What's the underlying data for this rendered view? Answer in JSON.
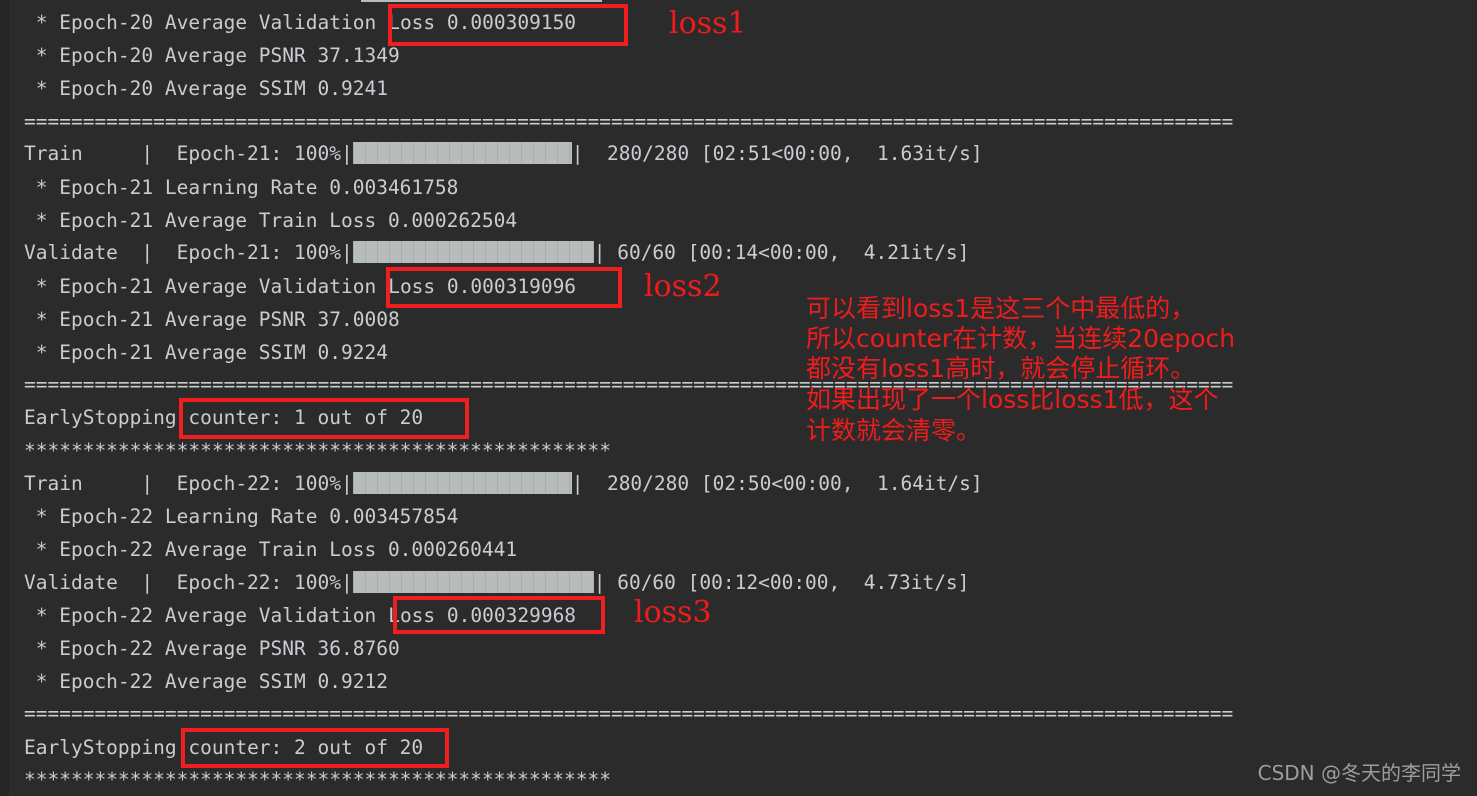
{
  "terminal": {
    "background_color": "#2b2b2b",
    "text_color": "#c9ccd1",
    "accent_color": "#ef1c1c",
    "bar_color": "#b9bcbd",
    "separator_equals": "=======================================================================================================",
    "separator_stars": "**************************************************"
  },
  "log_lines": [
    {
      "id": "e20_val_loss_prefix",
      "text": " * Epoch-20 Average Validation"
    },
    {
      "id": "e20_val_loss_value",
      "text": "Loss 0.000309150"
    },
    {
      "id": "e20_psnr",
      "text": " * Epoch-20 Average PSNR 37.1349"
    },
    {
      "id": "e20_ssim",
      "text": " * Epoch-20 Average SSIM 0.9241"
    },
    {
      "id": "e21_train_prefix",
      "text": "Train     |  Epoch-21: 100%|"
    },
    {
      "id": "e21_train_suffix",
      "text": "|  280/280 [02:51<00:00,  1.63it/s]"
    },
    {
      "id": "e21_lr",
      "text": " * Epoch-21 Learning Rate 0.003461758"
    },
    {
      "id": "e21_train_loss",
      "text": " * Epoch-21 Average Train Loss 0.000262504"
    },
    {
      "id": "e21_val_prefix",
      "text": "Validate  |  Epoch-21: 100%|"
    },
    {
      "id": "e21_val_suffix",
      "text": "| 60/60 [00:14<00:00,  4.21it/s]"
    },
    {
      "id": "e21_val_loss_prefix",
      "text": " * Epoch-21 Average Validation"
    },
    {
      "id": "e21_val_loss_value",
      "text": "Loss 0.000319096"
    },
    {
      "id": "e21_psnr",
      "text": " * Epoch-21 Average PSNR 37.0008"
    },
    {
      "id": "e21_ssim",
      "text": " * Epoch-21 Average SSIM 0.9224"
    },
    {
      "id": "es1_prefix",
      "text": "EarlyStopping"
    },
    {
      "id": "es1_counter",
      "text": " counter: 1 out of 20"
    },
    {
      "id": "e22_train_prefix",
      "text": "Train     |  Epoch-22: 100%|"
    },
    {
      "id": "e22_train_suffix",
      "text": "|  280/280 [02:50<00:00,  1.64it/s]"
    },
    {
      "id": "e22_lr",
      "text": " * Epoch-22 Learning Rate 0.003457854"
    },
    {
      "id": "e22_train_loss",
      "text": " * Epoch-22 Average Train Loss 0.000260441"
    },
    {
      "id": "e22_val_prefix",
      "text": "Validate  |  Epoch-22: 100%|"
    },
    {
      "id": "e22_val_suffix",
      "text": "| 60/60 [00:12<00:00,  4.73it/s]"
    },
    {
      "id": "e22_val_loss_prefix",
      "text": " * Epoch-22 Average Validation"
    },
    {
      "id": "e22_val_loss_value",
      "text": "Loss 0.000329968"
    },
    {
      "id": "e22_psnr",
      "text": " * Epoch-22 Average PSNR 36.8760"
    },
    {
      "id": "e22_ssim",
      "text": " * Epoch-22 Average SSIM 0.9212"
    },
    {
      "id": "es2_prefix",
      "text": "EarlyStopping"
    },
    {
      "id": "es2_counter",
      "text": " counter: 2 out of 20"
    }
  ],
  "annotations": {
    "loss1_label": "loss1",
    "loss2_label": "loss2",
    "loss3_label": "loss3",
    "chinese_note_line1": "可以看到loss1是这三个中最低的，",
    "chinese_note_line2": "所以counter在计数，当连续20epoch",
    "chinese_note_line3": "都没有loss1高时，就会停止循环。",
    "chinese_note_line4": "如果出现了一个loss比loss1低，这个",
    "chinese_note_line5": "计数就会清零。"
  },
  "watermark": {
    "text": "CSDN @冬天的李同学"
  }
}
